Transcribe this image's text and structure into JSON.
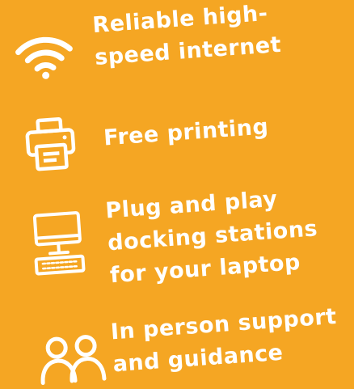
{
  "colors": {
    "background": "#f5a623",
    "foreground": "#ffffff"
  },
  "features": [
    {
      "icon": "wifi-icon",
      "lines": [
        "Reliable high-",
        "speed internet"
      ]
    },
    {
      "icon": "printer-icon",
      "lines": [
        "Free printing"
      ]
    },
    {
      "icon": "desktop-computer-icon",
      "lines": [
        "Plug and play",
        "docking stations",
        "for your laptop"
      ]
    },
    {
      "icon": "people-icon",
      "lines": [
        "In person support",
        "and guidance"
      ]
    }
  ]
}
